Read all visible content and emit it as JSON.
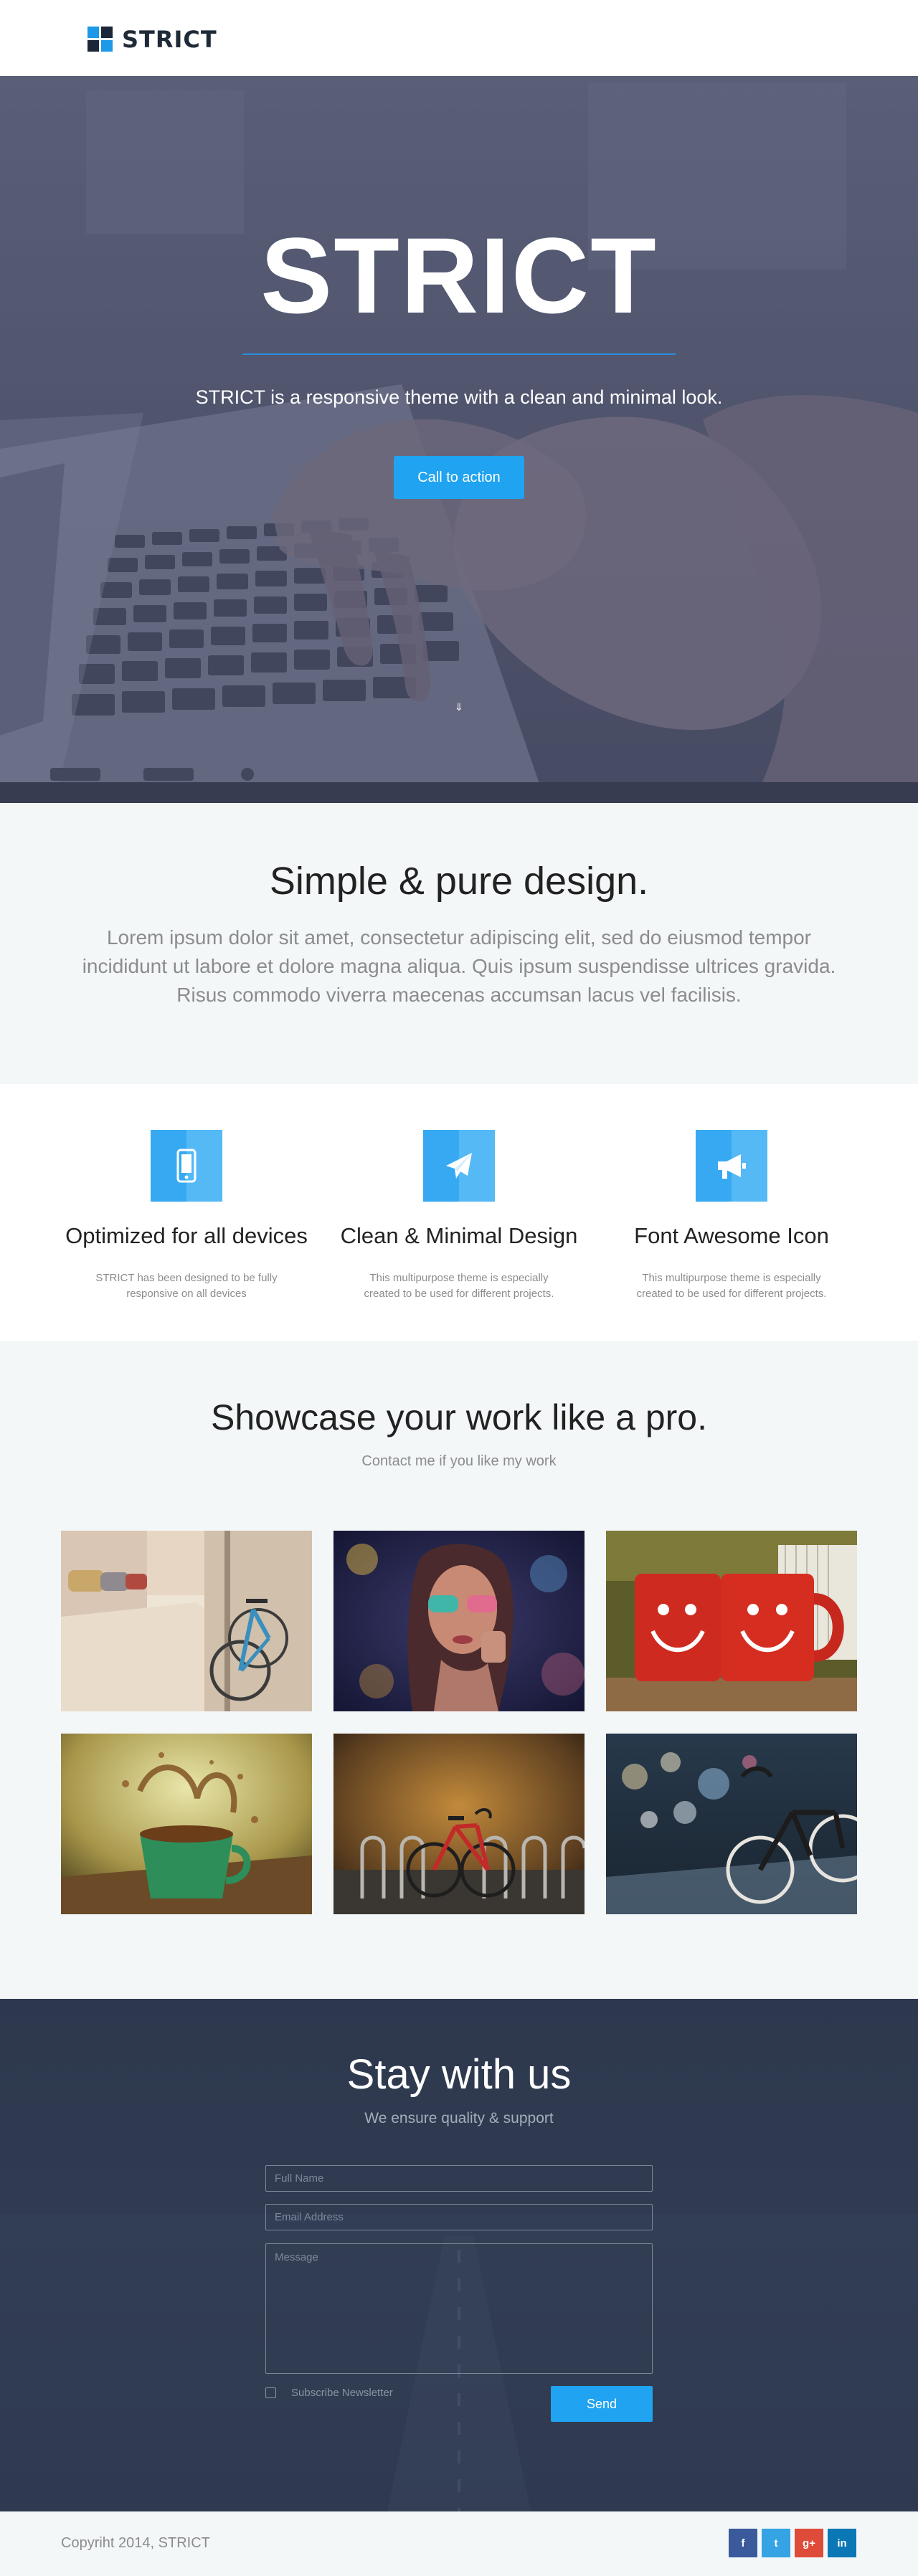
{
  "header": {
    "logo_text": "STRICT"
  },
  "hero": {
    "title": "STRICT",
    "subtitle": "STRICT is a responsive theme with a clean and minimal look.",
    "cta_label": "Call to action",
    "scroll_arrow": "⇓"
  },
  "intro": {
    "heading": "Simple & pure design.",
    "body": "Lorem ipsum dolor sit amet, consectetur adipiscing elit, sed do eiusmod tempor incididunt ut labore et dolore magna aliqua. Quis ipsum suspendisse ultrices gravida. Risus commodo viverra maecenas accumsan lacus vel facilisis."
  },
  "features": [
    {
      "icon": "mobile-phone-icon",
      "title": "Optimized for all devices",
      "text": "STRICT has been designed to be fully responsive on all devices"
    },
    {
      "icon": "paper-plane-icon",
      "title": "Clean & Minimal Design",
      "text": "This multipurpose theme is especially created to be used for different projects."
    },
    {
      "icon": "bullhorn-icon",
      "title": "Font Awesome Icon",
      "text": "This multipurpose theme is especially created to be used for different projects."
    }
  ],
  "showcase": {
    "heading": "Showcase your work like a pro.",
    "subheading": "Contact me if you like my work",
    "items": [
      "bicycle-street-photo",
      "woman-sunglasses-photo",
      "red-smiley-mugs-photo",
      "green-cup-splash-photo",
      "red-bicycle-rack-photo",
      "bicycle-bokeh-photo"
    ]
  },
  "contact": {
    "heading": "Stay with us",
    "subheading": "We ensure quality & support",
    "name_placeholder": "Full Name",
    "email_placeholder": "Email Address",
    "message_placeholder": "Message",
    "newsletter_label": "Subscribe Newsletter",
    "send_label": "Send"
  },
  "footer": {
    "copyright": "Copyriht 2014, STRICT",
    "social": {
      "facebook": "f",
      "twitter": "t",
      "googleplus": "g+",
      "linkedin": "in"
    }
  },
  "colors": {
    "accent": "#20a3f0",
    "dark": "#1f2a38",
    "light_bg": "#f3f7f8",
    "muted_text": "#8c8c8c"
  }
}
